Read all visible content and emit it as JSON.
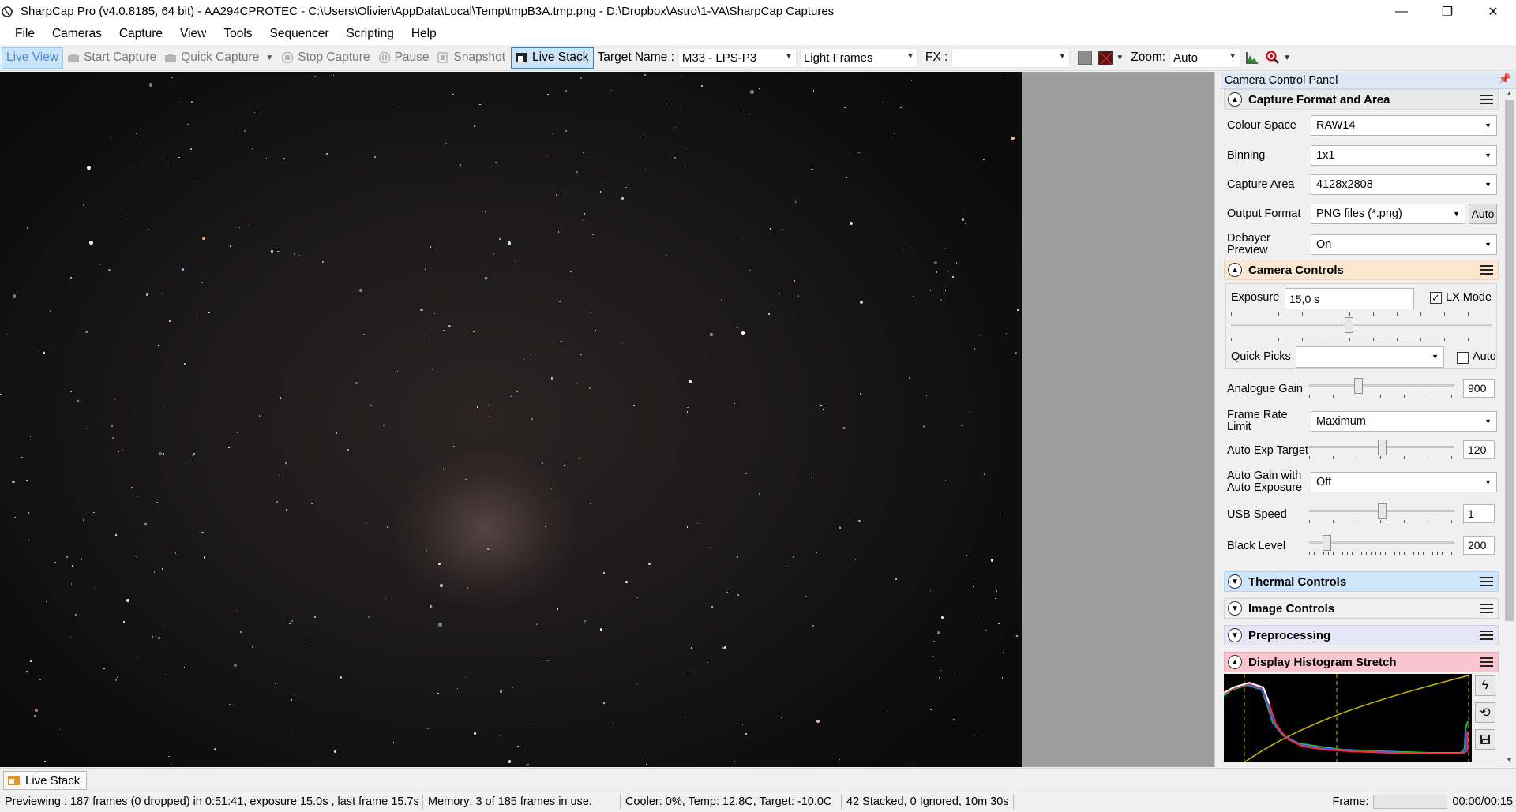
{
  "window": {
    "title": "SharpCap Pro (v4.0.8185, 64 bit) - AA294CPROTEC - C:\\Users\\Olivier\\AppData\\Local\\Temp\\tmpB3A.tmp.png - D:\\Dropbox\\Astro\\1-VA\\SharpCap Captures",
    "minimize": "—",
    "restore": "❐",
    "close": "✕"
  },
  "menu": [
    "File",
    "Cameras",
    "Capture",
    "View",
    "Tools",
    "Sequencer",
    "Scripting",
    "Help"
  ],
  "toolbar": {
    "live_view": "Live View",
    "start_capture": "Start Capture",
    "quick_capture": "Quick Capture",
    "stop_capture": "Stop Capture",
    "pause": "Pause",
    "snapshot": "Snapshot",
    "live_stack": "Live Stack",
    "target_name_label": "Target Name :",
    "target_name_value": "M33 - LPS-P3",
    "frame_type": "Light Frames",
    "fx_label": "FX :",
    "fx_value": "",
    "zoom_label": "Zoom:",
    "zoom_value": "Auto"
  },
  "panel": {
    "title": "Camera Control Panel",
    "capture_format": {
      "title": "Capture Format and Area",
      "colour_space_label": "Colour Space",
      "colour_space": "RAW14",
      "binning_label": "Binning",
      "binning": "1x1",
      "capture_area_label": "Capture Area",
      "capture_area": "4128x2808",
      "output_format_label": "Output Format",
      "output_format": "PNG files (*.png)",
      "auto_button": "Auto",
      "debayer_label": "Debayer Preview",
      "debayer": "On"
    },
    "camera_controls": {
      "title": "Camera Controls",
      "exposure_label": "Exposure",
      "exposure": "15,0 s",
      "lx_mode_label": "LX Mode",
      "lx_mode_checked": true,
      "quick_picks_label": "Quick Picks",
      "quick_picks": "",
      "auto_label": "Auto",
      "auto_checked": false,
      "analogue_gain_label": "Analogue Gain",
      "analogue_gain": "900",
      "frame_rate_label": "Frame Rate Limit",
      "frame_rate": "Maximum",
      "auto_exp_target_label": "Auto Exp Target",
      "auto_exp_target": "120",
      "auto_gain_label": "Auto Gain with Auto Exposure",
      "auto_gain": "Off",
      "usb_speed_label": "USB Speed",
      "usb_speed": "1",
      "black_level_label": "Black Level",
      "black_level": "200",
      "exposure_slider_level": 0.45,
      "gain_slider_level": 0.33,
      "auto_exp_slider_level": 0.5,
      "usb_slider_level": 0.5,
      "black_slider_level": 0.1
    },
    "collapsed_sections": [
      {
        "title": "Thermal Controls",
        "color": "#cfe6fb"
      },
      {
        "title": "Image Controls",
        "color": "#f0f0f0"
      },
      {
        "title": "Preprocessing",
        "color": "#e6e6f6"
      }
    ],
    "histogram": {
      "title": "Display Histogram Stretch",
      "color": "#f7c6cf"
    }
  },
  "tab": {
    "label": "Live Stack"
  },
  "status": {
    "preview": "Previewing : 187 frames (0 dropped) in 0:51:41, exposure 15.0s , last frame 15.7s",
    "memory": "Memory: 3 of 185 frames in use.",
    "cooler": "Cooler: 0%, Temp: 12.8C, Target: -10.0C",
    "stacked": "42 Stacked, 0 Ignored, 10m 30s",
    "frame_label": "Frame:",
    "time": "00:00/00:15"
  }
}
